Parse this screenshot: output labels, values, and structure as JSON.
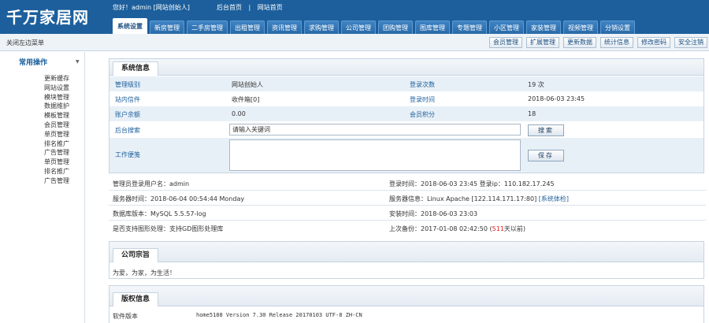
{
  "header": {
    "logo": "千万家居网",
    "greeting": "您好！admin [网站创始人]",
    "links": [
      "后台首页",
      "|",
      "网站首页"
    ],
    "tabs": [
      "系统设置",
      "新房管理",
      "二手房管理",
      "出租管理",
      "资讯管理",
      "求购管理",
      "公司管理",
      "团购管理",
      "图库管理",
      "专题管理",
      "小区管理",
      "家装管理",
      "视频管理",
      "分销设置"
    ]
  },
  "subbar": {
    "close_left": "关闭左边菜单",
    "buttons": [
      "会员管理",
      "扩展管理",
      "更新数据",
      "统计信息",
      "修改密码",
      "安全注销"
    ]
  },
  "sidebar": {
    "title": "常用操作",
    "toggle": "▼",
    "items": [
      "更新缓存",
      "网站设置",
      "模块管理",
      "数据维护",
      "模板管理",
      "会员管理",
      "单页管理",
      "排名推广",
      "广告管理",
      "单页管理",
      "排名推广",
      "广告管理"
    ]
  },
  "system_info": {
    "title": "系统信息",
    "rows": [
      {
        "l1": "管理级别",
        "v1": "网站创始人",
        "l2": "登录次数",
        "v2": "19 次"
      },
      {
        "l1": "站内信件",
        "v1": "收件箱[0]",
        "l2": "登录时间",
        "v2": "2018-06-03 23:45"
      },
      {
        "l1": "账户余额",
        "v1": "0.00",
        "l2": "会员积分",
        "v2": "18"
      }
    ],
    "search_label": "后台搜索",
    "search_placeholder": "请输入关键词",
    "search_button": "搜索",
    "memo_label": "工作便笺",
    "save_button": "保存"
  },
  "details": {
    "admin_user": "管理员登录用户名：admin",
    "login_time": "登录时间：2018-06-03 23:45 登录ip：110.182.17.245",
    "server_time": "服务器时间：2018-06-04 00:54:44 Monday",
    "server_info": "服务器信息：Linux Apache [122.114.171.17:80]",
    "system_check": "[系统体检]",
    "db_version": "数据库版本：MySQL 5.5.57-log",
    "install_time": "安装时间：2018-06-03 23:03",
    "graphics": "是否支持图形处理：支持GD图形处理库",
    "backup_prefix": "上次备份：2017-01-08 02:42:50 (",
    "backup_days": "511",
    "backup_suffix": "天以前)"
  },
  "company": {
    "title": "公司宗旨",
    "text": "为爱，为家，为生活！"
  },
  "copyright": {
    "title": "版权信息",
    "label": "软件版本",
    "value": "home5188 Version 7.30 Release 20170103 UTF-8 ZH-CN"
  }
}
